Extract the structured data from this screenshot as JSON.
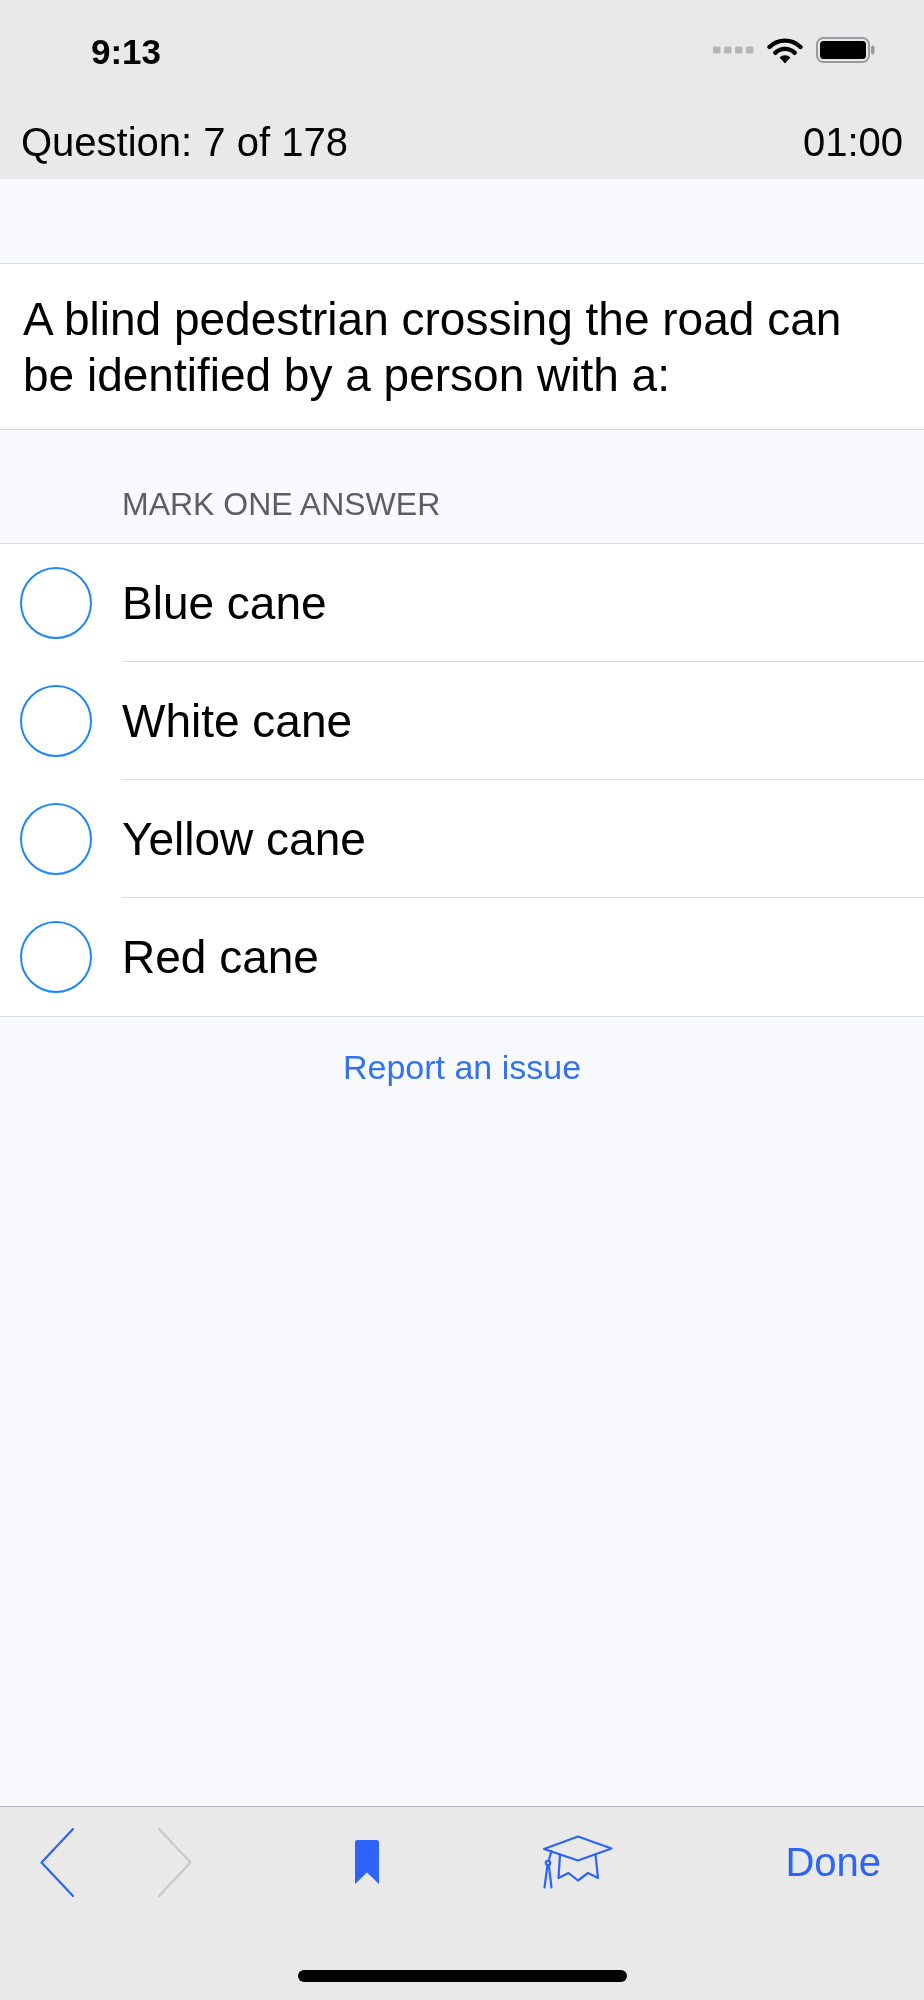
{
  "status_bar": {
    "time": "9:13"
  },
  "header": {
    "progress": "Question: 7 of 178",
    "timer": "01:00"
  },
  "question": {
    "text": "A blind pedestrian crossing the road can be identified by a person with a:"
  },
  "answers": {
    "instruction": "MARK ONE ANSWER",
    "options": [
      {
        "label": "Blue cane",
        "selected": false
      },
      {
        "label": "White cane",
        "selected": false
      },
      {
        "label": "Yellow cane",
        "selected": false
      },
      {
        "label": "Red cane",
        "selected": false
      }
    ]
  },
  "report_link": "Report an issue",
  "toolbar": {
    "items": [
      {
        "kind": "back",
        "disabled": false
      },
      {
        "kind": "forward",
        "disabled": true
      },
      {
        "kind": "bookmark",
        "bookmarked": true
      },
      {
        "kind": "learn"
      },
      {
        "kind": "text",
        "label": "Done"
      }
    ]
  }
}
